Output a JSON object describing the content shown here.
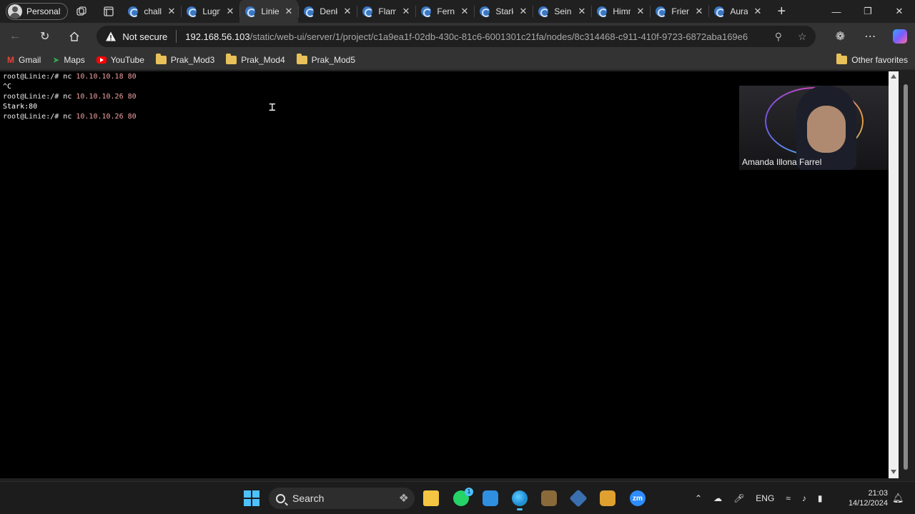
{
  "browser": {
    "profile_label": "Personal",
    "tabs": [
      {
        "title": "chall",
        "active": false
      },
      {
        "title": "Lugn",
        "active": false
      },
      {
        "title": "Linie",
        "active": true
      },
      {
        "title": "Denk",
        "active": false
      },
      {
        "title": "Flam",
        "active": false
      },
      {
        "title": "Fern",
        "active": false
      },
      {
        "title": "Stark",
        "active": false
      },
      {
        "title": "Sein",
        "active": false
      },
      {
        "title": "Himr",
        "active": false
      },
      {
        "title": "Frien",
        "active": false
      },
      {
        "title": "Aura",
        "active": false
      }
    ],
    "security_label": "Not secure",
    "url_host": "192.168.56.103",
    "url_path": "/static/web-ui/server/1/project/c1a9ea1f-02db-430c-81c6-6001301c21fa/nodes/8c314468-c911-410f-9723-6872aba169e6",
    "favorites": [
      {
        "label": "Gmail",
        "icon": "gmail-icon"
      },
      {
        "label": "Maps",
        "icon": "maps-icon"
      },
      {
        "label": "YouTube",
        "icon": "youtube-icon"
      },
      {
        "label": "Prak_Mod3",
        "icon": "folder-icon"
      },
      {
        "label": "Prak_Mod4",
        "icon": "folder-icon"
      },
      {
        "label": "Prak_Mod5",
        "icon": "folder-icon"
      }
    ],
    "other_favorites": "Other favorites"
  },
  "terminal": {
    "lines": [
      {
        "prompt": "root@Linie:/# ",
        "cmd": "nc ",
        "args": "10.10.10.18 80"
      },
      {
        "prompt": "",
        "cmd": "^C",
        "args": ""
      },
      {
        "prompt": "root@Linie:/# ",
        "cmd": "nc ",
        "args": "10.10.10.26 80"
      },
      {
        "prompt": "",
        "cmd": "Stark:80",
        "args": ""
      },
      {
        "prompt": "root@Linie:/# ",
        "cmd": "nc ",
        "args": "10.10.10.26 80"
      }
    ]
  },
  "webcam": {
    "participant_name": "Amanda Illona Farrel"
  },
  "taskbar": {
    "search_label": "Search",
    "whatsapp_badge": "1",
    "zoom_label": "zm",
    "language": "ENG",
    "time": "21:03",
    "date": "14/12/2024"
  }
}
